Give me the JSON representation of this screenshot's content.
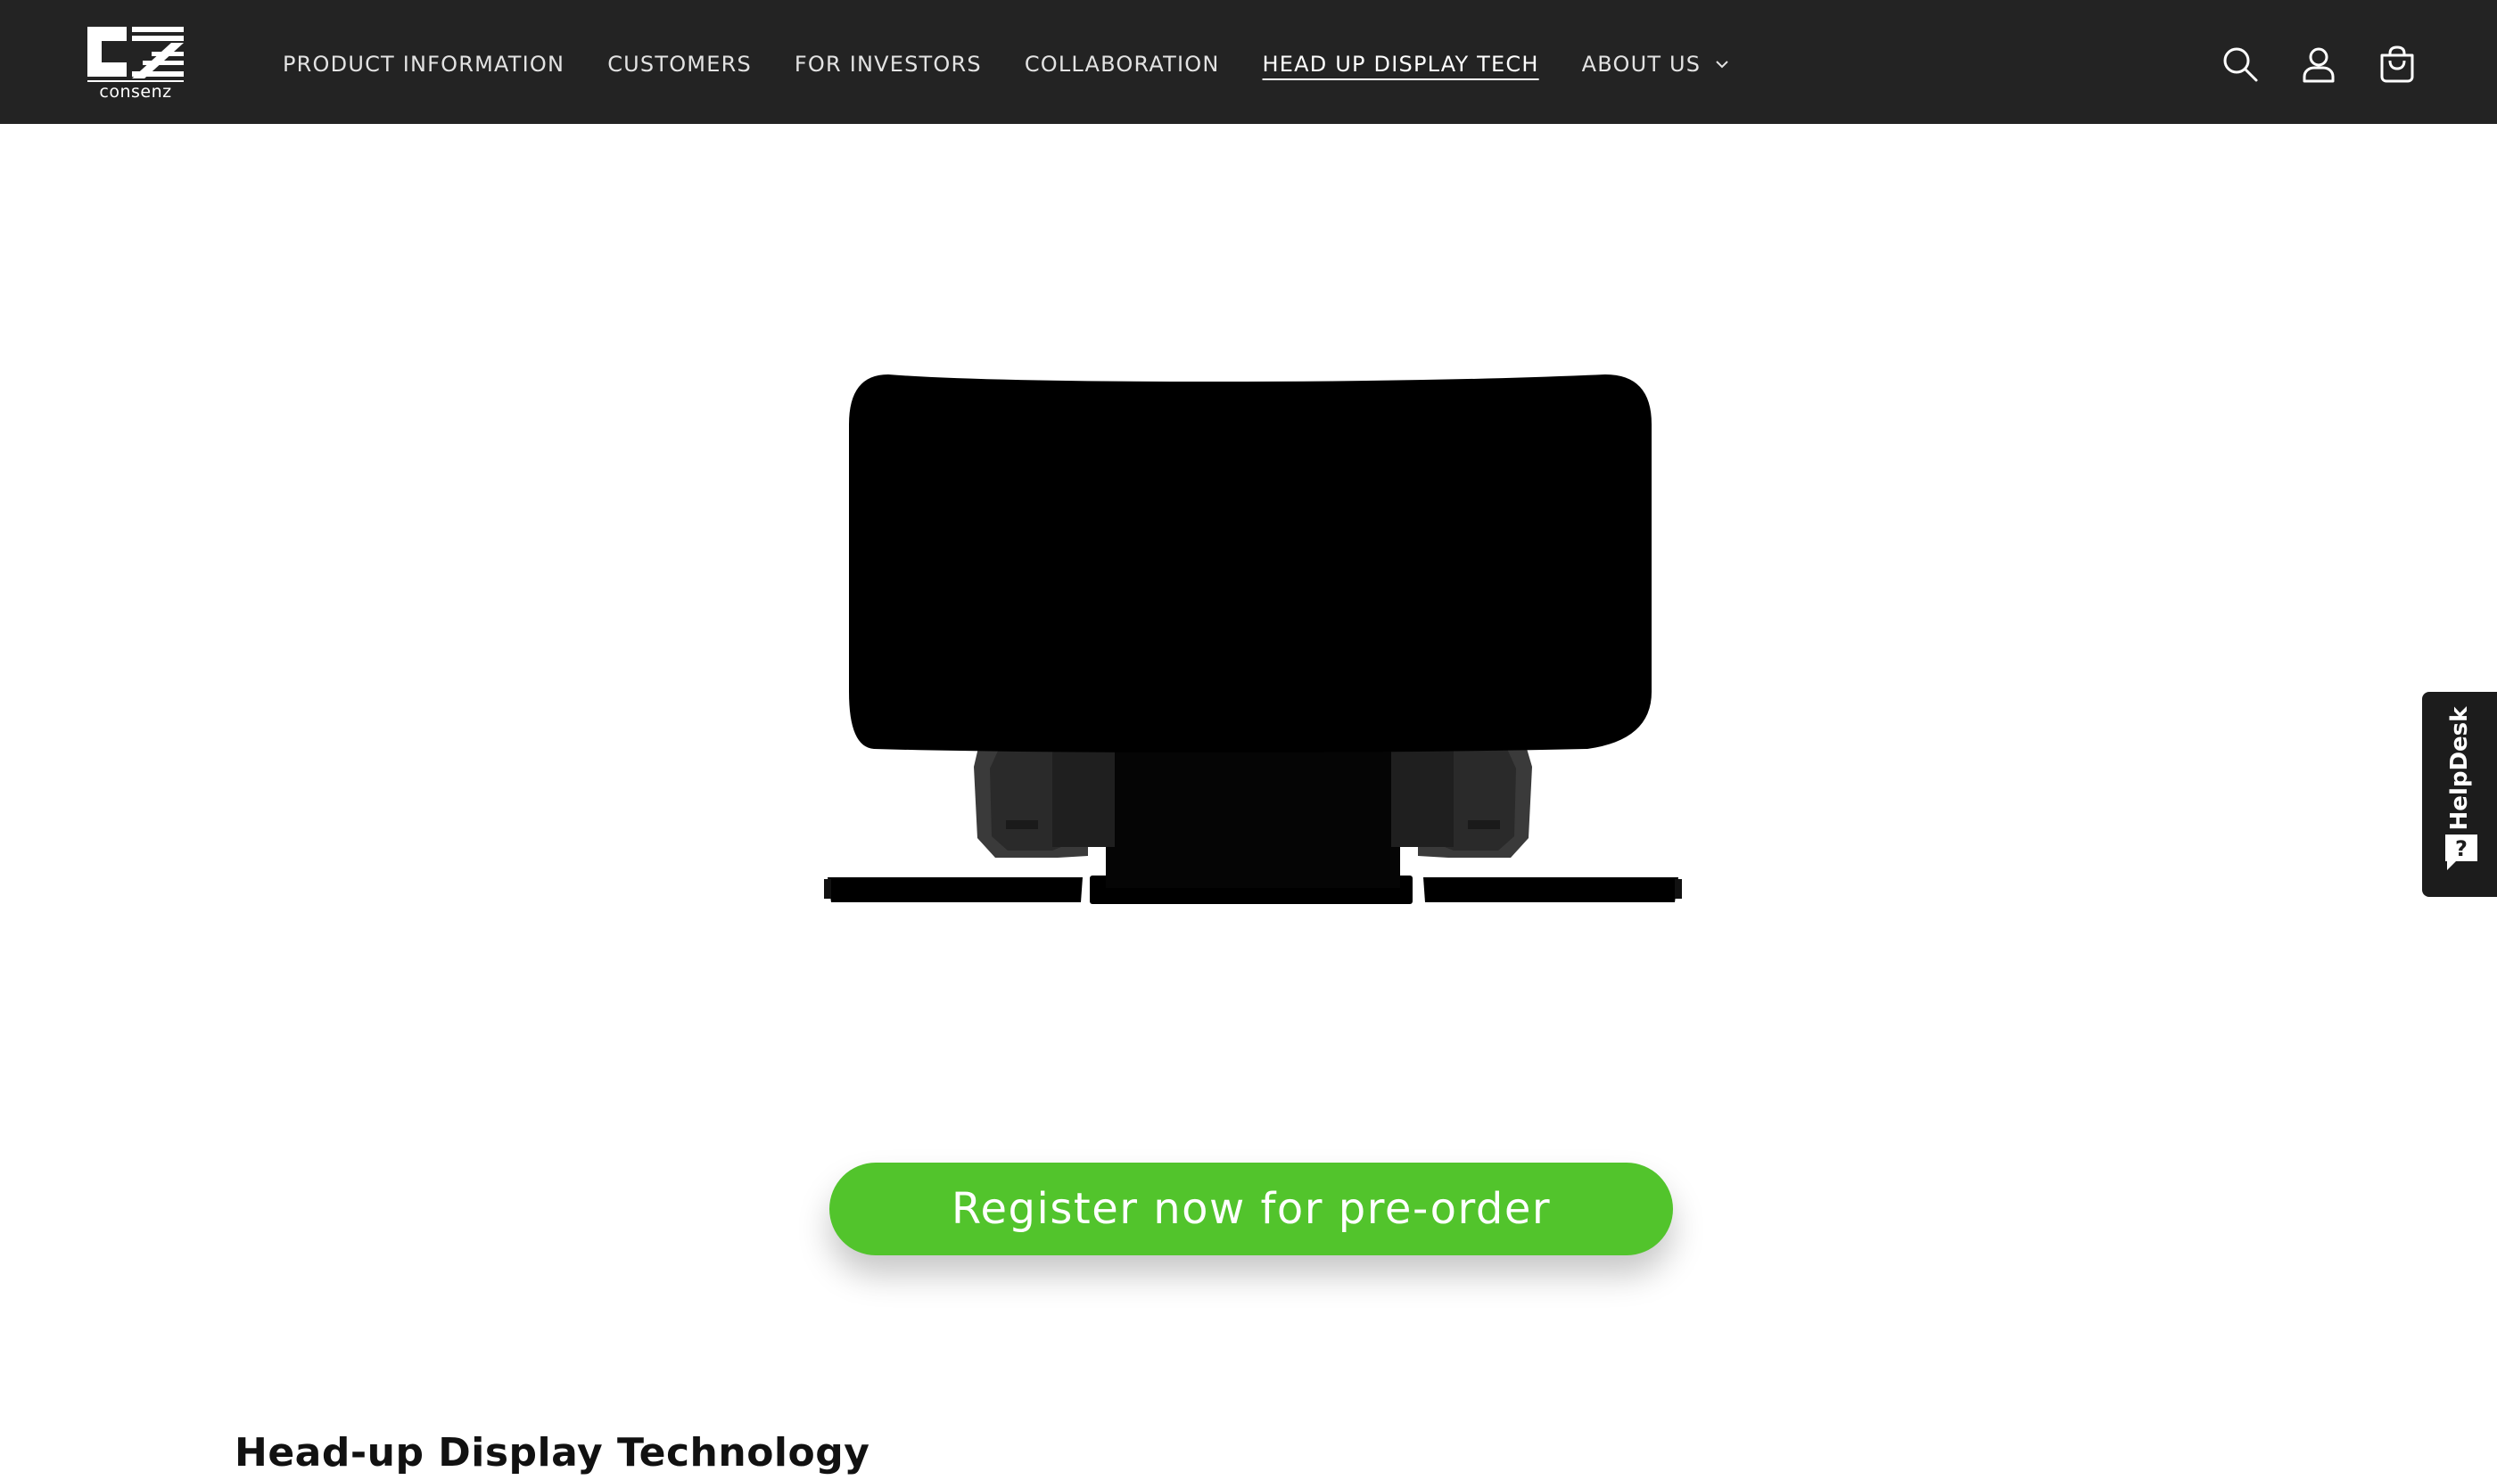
{
  "brand": {
    "name": "consenz"
  },
  "nav": {
    "items": [
      {
        "label": "PRODUCT INFORMATION",
        "active": false,
        "has_dropdown": false
      },
      {
        "label": "CUSTOMERS",
        "active": false,
        "has_dropdown": false
      },
      {
        "label": "FOR INVESTORS",
        "active": false,
        "has_dropdown": false
      },
      {
        "label": "COLLABORATION",
        "active": false,
        "has_dropdown": false
      },
      {
        "label": "HEAD UP DISPLAY TECH",
        "active": true,
        "has_dropdown": false
      },
      {
        "label": "ABOUT US",
        "active": false,
        "has_dropdown": true
      }
    ]
  },
  "header_icons": [
    "search-icon",
    "account-icon",
    "cart-icon"
  ],
  "hero": {
    "cta_label": "Register now for pre-order"
  },
  "section": {
    "title": "Head-up Display Technology"
  },
  "helpdesk": {
    "label": "HelpDesk",
    "icon": "question-chat-icon"
  },
  "colors": {
    "header_bg": "#232323",
    "cta_bg": "#52c42c",
    "helpdesk_bg": "#1c1c1c",
    "text_dark": "#111111"
  }
}
